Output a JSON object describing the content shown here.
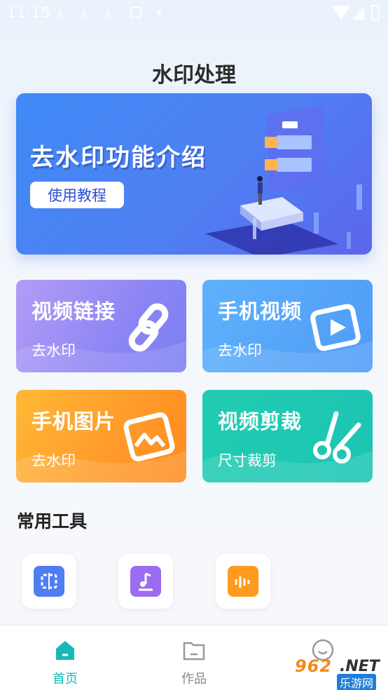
{
  "status_bar": {
    "time": "11:15",
    "download_glyph": "⤓"
  },
  "page_title": "水印处理",
  "banner": {
    "title": "去水印功能介绍",
    "button_label": "使用教程"
  },
  "cards": [
    {
      "title": "视频链接",
      "subtitle": "去水印",
      "icon": "link-icon"
    },
    {
      "title": "手机视频",
      "subtitle": "去水印",
      "icon": "video-play-icon"
    },
    {
      "title": "手机图片",
      "subtitle": "去水印",
      "icon": "image-icon"
    },
    {
      "title": "视频剪裁",
      "subtitle": "尺寸裁剪",
      "icon": "scissors-icon"
    }
  ],
  "section": {
    "title": "常用工具"
  },
  "tools": [
    {
      "icon": "split-icon",
      "color": "#4f7df2"
    },
    {
      "icon": "music-icon",
      "color": "#9b6cf0"
    },
    {
      "icon": "audio-icon",
      "color": "#ff9a1f"
    }
  ],
  "bottom_nav": {
    "items": [
      {
        "label": "首页",
        "active": true,
        "icon": "home-icon",
        "color": "#19b8b8"
      },
      {
        "label": "作品",
        "active": false,
        "icon": "folder-icon",
        "color": "#999999"
      },
      {
        "label": "",
        "active": false,
        "icon": "profile-icon",
        "color": "#999999"
      }
    ]
  },
  "watermark": {
    "number": "962",
    "suffix": ".NET",
    "site": "乐游网"
  }
}
